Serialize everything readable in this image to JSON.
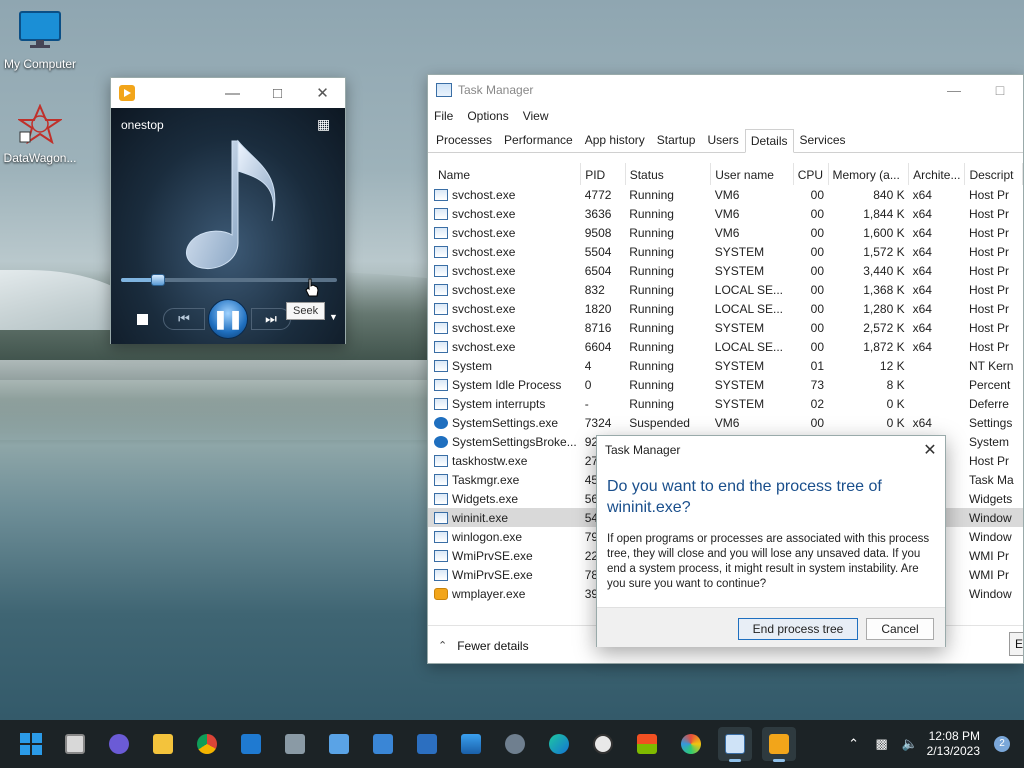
{
  "desktop": {
    "icons": [
      {
        "label": "My Computer",
        "icon": "monitor-icon"
      },
      {
        "label": "DataWagon...",
        "icon": "datawagon-icon"
      }
    ]
  },
  "media_player": {
    "track_title": "onestop",
    "seek_tooltip": "Seek",
    "seek_fraction": 0.17,
    "icons": {
      "app": "wmp-icon",
      "minimize": "minimize-icon",
      "maximize": "maximize-icon",
      "close": "close-icon",
      "switch": "switch-to-library-icon",
      "stop": "stop-icon",
      "previous": "previous-icon",
      "pause": "pause-icon",
      "next": "next-icon",
      "more": "chevron-down-icon"
    }
  },
  "task_manager": {
    "title": "Task Manager",
    "menu": [
      "File",
      "Options",
      "View"
    ],
    "tabs": [
      "Processes",
      "Performance",
      "App history",
      "Startup",
      "Users",
      "Details",
      "Services"
    ],
    "active_tab": "Details",
    "columns": [
      "Name",
      "PID",
      "Status",
      "User name",
      "CPU",
      "Memory (a...",
      "Archite...",
      "Descript"
    ],
    "rows": [
      {
        "name": "svchost.exe",
        "pid": "4772",
        "status": "Running",
        "user": "VM6",
        "cpu": "00",
        "memory": "840 K",
        "arch": "x64",
        "desc": "Host Pr"
      },
      {
        "name": "svchost.exe",
        "pid": "3636",
        "status": "Running",
        "user": "VM6",
        "cpu": "00",
        "memory": "1,844 K",
        "arch": "x64",
        "desc": "Host Pr"
      },
      {
        "name": "svchost.exe",
        "pid": "9508",
        "status": "Running",
        "user": "VM6",
        "cpu": "00",
        "memory": "1,600 K",
        "arch": "x64",
        "desc": "Host Pr"
      },
      {
        "name": "svchost.exe",
        "pid": "5504",
        "status": "Running",
        "user": "SYSTEM",
        "cpu": "00",
        "memory": "1,572 K",
        "arch": "x64",
        "desc": "Host Pr"
      },
      {
        "name": "svchost.exe",
        "pid": "6504",
        "status": "Running",
        "user": "SYSTEM",
        "cpu": "00",
        "memory": "3,440 K",
        "arch": "x64",
        "desc": "Host Pr"
      },
      {
        "name": "svchost.exe",
        "pid": "832",
        "status": "Running",
        "user": "LOCAL SE...",
        "cpu": "00",
        "memory": "1,368 K",
        "arch": "x64",
        "desc": "Host Pr"
      },
      {
        "name": "svchost.exe",
        "pid": "1820",
        "status": "Running",
        "user": "LOCAL SE...",
        "cpu": "00",
        "memory": "1,280 K",
        "arch": "x64",
        "desc": "Host Pr"
      },
      {
        "name": "svchost.exe",
        "pid": "8716",
        "status": "Running",
        "user": "SYSTEM",
        "cpu": "00",
        "memory": "2,572 K",
        "arch": "x64",
        "desc": "Host Pr"
      },
      {
        "name": "svchost.exe",
        "pid": "6604",
        "status": "Running",
        "user": "LOCAL SE...",
        "cpu": "00",
        "memory": "1,872 K",
        "arch": "x64",
        "desc": "Host Pr"
      },
      {
        "name": "System",
        "pid": "4",
        "status": "Running",
        "user": "SYSTEM",
        "cpu": "01",
        "memory": "12 K",
        "arch": "",
        "desc": "NT Kern"
      },
      {
        "name": "System Idle Process",
        "pid": "0",
        "status": "Running",
        "user": "SYSTEM",
        "cpu": "73",
        "memory": "8 K",
        "arch": "",
        "desc": "Percent"
      },
      {
        "name": "System interrupts",
        "pid": "-",
        "status": "Running",
        "user": "SYSTEM",
        "cpu": "02",
        "memory": "0 K",
        "arch": "",
        "desc": "Deferre"
      },
      {
        "name": "SystemSettings.exe",
        "pid": "7324",
        "status": "Suspended",
        "user": "VM6",
        "cpu": "00",
        "memory": "0 K",
        "arch": "x64",
        "desc": "Settings"
      },
      {
        "name": "SystemSettingsBroke...",
        "pid": "924",
        "status": "",
        "user": "",
        "cpu": "",
        "memory": "",
        "arch": "",
        "desc": "System"
      },
      {
        "name": "taskhostw.exe",
        "pid": "279",
        "status": "",
        "user": "",
        "cpu": "",
        "memory": "",
        "arch": "",
        "desc": "Host Pr"
      },
      {
        "name": "Taskmgr.exe",
        "pid": "458",
        "status": "",
        "user": "",
        "cpu": "",
        "memory": "",
        "arch": "",
        "desc": "Task Ma"
      },
      {
        "name": "Widgets.exe",
        "pid": "560",
        "status": "",
        "user": "",
        "cpu": "",
        "memory": "",
        "arch": "",
        "desc": "Widgets"
      },
      {
        "name": "wininit.exe",
        "pid": "544",
        "status": "",
        "user": "",
        "cpu": "",
        "memory": "",
        "arch": "",
        "desc": "Window",
        "selected": true
      },
      {
        "name": "winlogon.exe",
        "pid": "794",
        "status": "",
        "user": "",
        "cpu": "",
        "memory": "",
        "arch": "",
        "desc": "Window"
      },
      {
        "name": "WmiPrvSE.exe",
        "pid": "228",
        "status": "",
        "user": "",
        "cpu": "",
        "memory": "",
        "arch": "",
        "desc": "WMI Pr"
      },
      {
        "name": "WmiPrvSE.exe",
        "pid": "788",
        "status": "",
        "user": "",
        "cpu": "",
        "memory": "",
        "arch": "",
        "desc": "WMI Pr"
      },
      {
        "name": "wmplayer.exe",
        "pid": "398",
        "status": "",
        "user": "",
        "cpu": "",
        "memory": "",
        "arch": "",
        "desc": "Window"
      }
    ],
    "fewer_details": "Fewer details",
    "end_task_partial": "E"
  },
  "dialog": {
    "title": "Task Manager",
    "question": "Do you want to end the process tree of wininit.exe?",
    "message": "If open programs or processes are associated with this process tree, they will close and you will lose any unsaved data. If you end a system process, it might result in system instability. Are you sure you want to continue?",
    "confirm_label": "End process tree",
    "cancel_label": "Cancel"
  },
  "taskbar": {
    "apps": [
      "start-icon",
      "task-view-icon",
      "teams-chat-icon",
      "file-explorer-icon",
      "chrome-icon",
      "calendar-icon",
      "calculator-icon",
      "notepad-icon",
      "remote-desktop-icon",
      "media-app-icon",
      "photos-icon",
      "settings-icon",
      "edge-icon",
      "clock-icon",
      "store-icon",
      "paint-icon",
      "task-manager-icon",
      "media-player-icon"
    ],
    "active": [
      "task-manager-icon",
      "media-player-icon"
    ],
    "time": "12:08 PM",
    "date": "2/13/2023",
    "notification_count": "2"
  }
}
